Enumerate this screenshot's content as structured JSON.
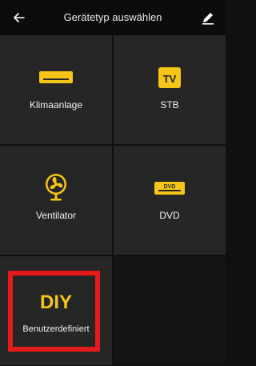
{
  "header": {
    "title": "Gerätetyp auswählen",
    "back_icon": "arrow-left-icon",
    "edit_icon": "pencil-icon"
  },
  "devices": [
    {
      "label": "Klimaanlage",
      "icon": "air-conditioner-icon"
    },
    {
      "label": "STB",
      "icon": "tv-icon",
      "icon_text": "TV"
    },
    {
      "label": "Ventilator",
      "icon": "fan-icon"
    },
    {
      "label": "DVD",
      "icon": "dvd-player-icon",
      "icon_text": "DVD"
    },
    {
      "label": "Benutzerdefiniert",
      "icon_text": "DIY"
    }
  ],
  "colors": {
    "accent": "#f5c518",
    "highlight": "#e51a1a",
    "tile": "#262626",
    "background": "#101010"
  }
}
